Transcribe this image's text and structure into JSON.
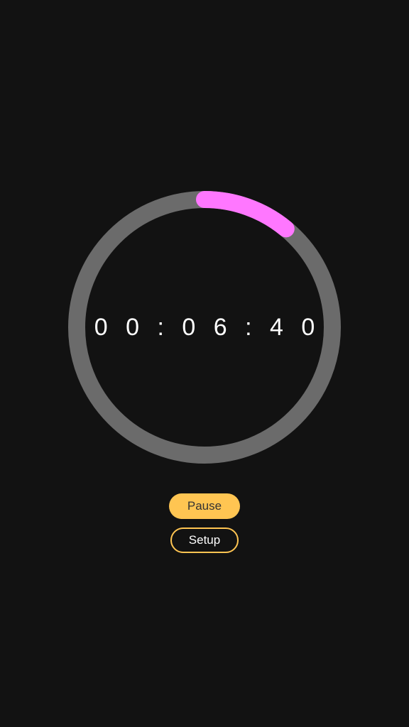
{
  "timer": {
    "display": "00:06:40",
    "progress_fraction": 0.11
  },
  "controls": {
    "pause_label": "Pause",
    "setup_label": "Setup"
  },
  "colors": {
    "background": "#121212",
    "ring_track": "#6b6b6b",
    "ring_progress": "#ff77ff",
    "accent": "#ffc552"
  }
}
